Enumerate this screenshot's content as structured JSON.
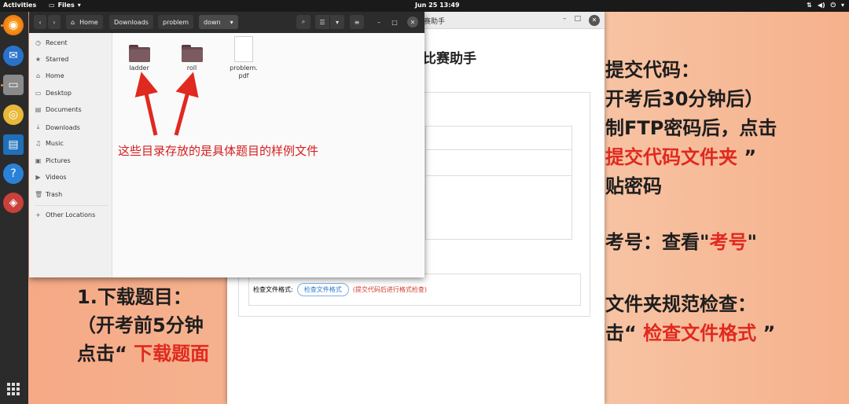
{
  "topbar": {
    "activities": "Activities",
    "app_name": "Files",
    "clock": "Jun 25  13:49"
  },
  "assistant_window": {
    "title": "赛助手",
    "heading": "比赛助手",
    "check_label": "检查文件格式:",
    "check_button": "检查文件格式",
    "check_hint": "(提交代码后进行格式检查)"
  },
  "instructions_right": [
    {
      "text": "提交代码："
    },
    {
      "text": "开考后30分钟后）"
    },
    {
      "text": "制FTP密码后，点击"
    },
    {
      "pre": "",
      "red": "提交代码文件夹",
      "post": " ”"
    },
    {
      "text": "贴密码"
    },
    {
      "pre": "考号：查看\"",
      "red": "考号",
      "post": "\""
    },
    {
      "text": "文件夹规范检查："
    },
    {
      "pre": "击“ ",
      "red": "检查文件格式",
      "post": " ”"
    }
  ],
  "instructions_left": [
    {
      "text": "1.下载题目："
    },
    {
      "text": "（开考前5分钟"
    },
    {
      "pre": "点击“ ",
      "red": "下载题面",
      "post": ""
    }
  ],
  "files_window": {
    "breadcrumbs": [
      "Home",
      "Downloads",
      "problem",
      "down"
    ],
    "sidebar": [
      {
        "icon": "clock-icon",
        "glyph": "◷",
        "label": "Recent"
      },
      {
        "icon": "star-icon",
        "glyph": "★",
        "label": "Starred"
      },
      {
        "icon": "home-icon",
        "glyph": "⌂",
        "label": "Home"
      },
      {
        "icon": "desktop-icon",
        "glyph": "▭",
        "label": "Desktop"
      },
      {
        "icon": "documents-icon",
        "glyph": "▤",
        "label": "Documents"
      },
      {
        "icon": "downloads-icon",
        "glyph": "⤓",
        "label": "Downloads"
      },
      {
        "icon": "music-icon",
        "glyph": "♫",
        "label": "Music"
      },
      {
        "icon": "pictures-icon",
        "glyph": "▣",
        "label": "Pictures"
      },
      {
        "icon": "videos-icon",
        "glyph": "▶",
        "label": "Videos"
      },
      {
        "icon": "trash-icon",
        "glyph": "🗑",
        "label": "Trash"
      }
    ],
    "other_locations": "Other Locations",
    "items": [
      {
        "type": "folder",
        "name": "ladder"
      },
      {
        "type": "folder",
        "name": "roll"
      },
      {
        "type": "file",
        "name_line1": "problem.",
        "name_line2": "pdf"
      }
    ],
    "annotation": "这些目录存放的是具体题目的样例文件"
  },
  "colors": {
    "accent_red": "#e0291f",
    "ubuntu_orange": "#e95420",
    "folder": "#6a4a50"
  }
}
